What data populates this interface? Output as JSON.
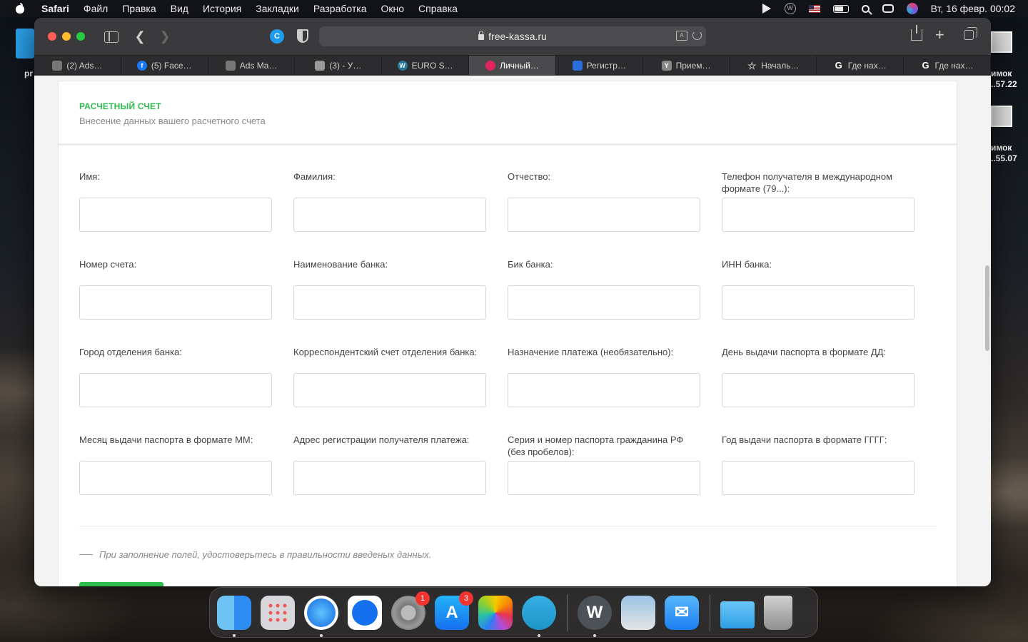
{
  "menubar": {
    "app_name": "Safari",
    "menus": [
      "Файл",
      "Правка",
      "Вид",
      "История",
      "Закладки",
      "Разработка",
      "Окно",
      "Справка"
    ],
    "clock": "Вт, 16 февр.  00:02"
  },
  "desktop": {
    "left_label": "pr",
    "right_label_1": "имок ..57.22",
    "right_label_2": "имок ..55.07"
  },
  "toolbar": {
    "url": "free-kassa.ru"
  },
  "tabs": [
    {
      "label": "(2) Ads…",
      "icon": "ads-icon",
      "color": "#888"
    },
    {
      "label": "(5) Face…",
      "icon": "facebook-icon",
      "color": "#1877f2"
    },
    {
      "label": "Ads Ma…",
      "icon": "ads-icon",
      "color": "#888"
    },
    {
      "label": "(3)    - У…",
      "icon": "page-icon",
      "color": "#999"
    },
    {
      "label": "EURO S…",
      "icon": "wordpress-icon",
      "color": "#21759b"
    },
    {
      "label": "Личный…",
      "icon": "freekassa-icon",
      "color": "#e0245e",
      "active": true
    },
    {
      "label": "Регистр…",
      "icon": "reg-icon",
      "color": "#2a6edb"
    },
    {
      "label": "Прием…",
      "icon": "yandex-icon",
      "color": "#888"
    },
    {
      "label": "Началь…",
      "icon": "star-icon",
      "color": "transparent"
    },
    {
      "label": "Где нах…",
      "icon": "google-icon",
      "color": "transparent"
    },
    {
      "label": "Где нах…",
      "icon": "google-icon",
      "color": "transparent"
    }
  ],
  "card": {
    "title": "РАСЧЕТНЫЙ СЧЕТ",
    "subtitle": "Внесение данных вашего расчетного счета"
  },
  "fields": [
    {
      "label": "Имя:",
      "value": ""
    },
    {
      "label": "Фамилия:",
      "value": ""
    },
    {
      "label": "Отчество:",
      "value": ""
    },
    {
      "label": "Телефон получателя в международном формате (79...):",
      "value": ""
    },
    {
      "label": "Номер счета:",
      "value": ""
    },
    {
      "label": "Наименование банка:",
      "value": ""
    },
    {
      "label": "Бик банка:",
      "value": ""
    },
    {
      "label": "ИНН банка:",
      "value": ""
    },
    {
      "label": "Город отделения банка:",
      "value": ""
    },
    {
      "label": "Корреспондентский счет отделения банка:",
      "value": ""
    },
    {
      "label": "Назначение платежа (необязательно):",
      "value": ""
    },
    {
      "label": "День выдачи паспорта в формате ДД:",
      "value": ""
    },
    {
      "label": "Месяц выдачи паспорта в формате ММ:",
      "value": ""
    },
    {
      "label": "Адрес регистрации получателя платежа:",
      "value": ""
    },
    {
      "label": "Серия и номер паспорта гражданина РФ (без пробелов):",
      "value": ""
    },
    {
      "label": "Год выдачи паспорта в формате ГГГГ:",
      "value": ""
    }
  ],
  "note": "При заполнение полей, удостоверьтесь в правильности введеных данных.",
  "dock": {
    "apps": [
      "finder-icon",
      "launchpad-icon",
      "safari-icon",
      "teamviewer-icon",
      "system-preferences-icon",
      "app-store-icon",
      "photos-icon",
      "telegram-icon",
      "wclient-icon",
      "preview-icon",
      "mail-icon",
      "downloads-folder-icon",
      "trash-icon"
    ],
    "settings_badge": "1",
    "appstore_badge": "3"
  }
}
